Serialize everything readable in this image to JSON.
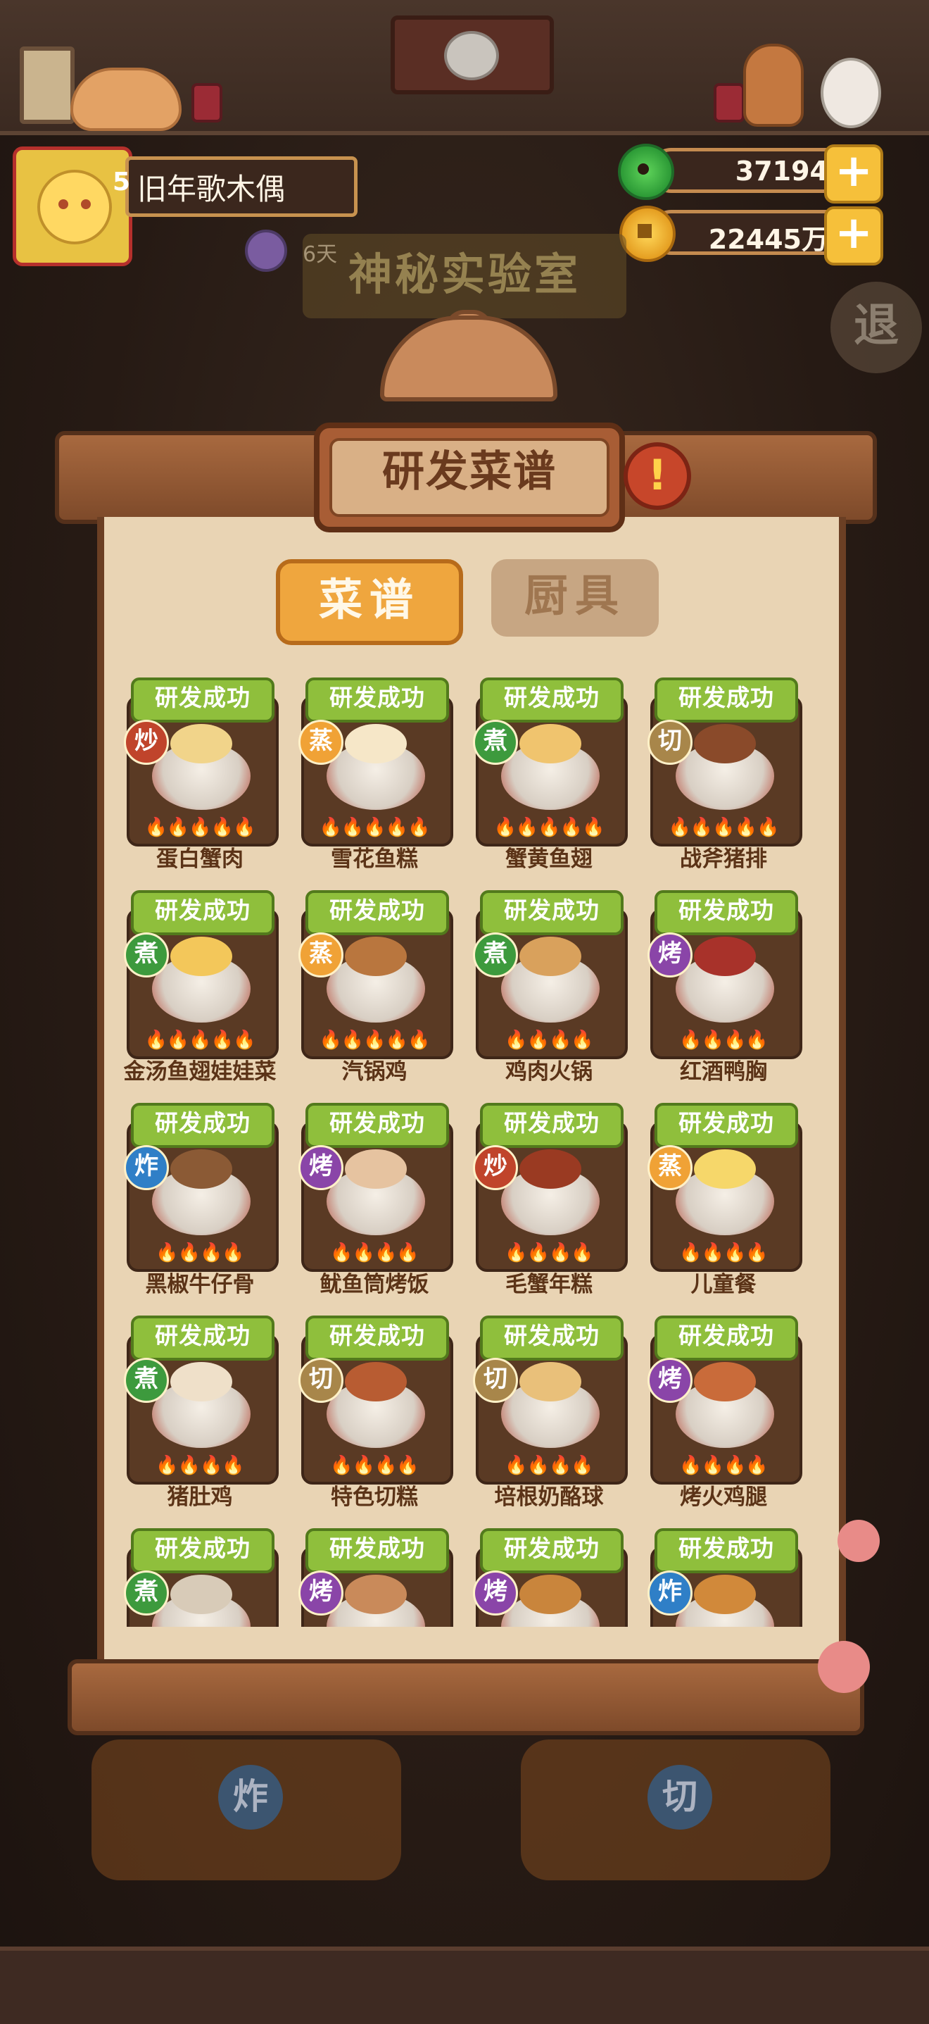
{
  "player": {
    "name": "旧年歌木偶",
    "level": "5",
    "status_days": "6天"
  },
  "resources": {
    "jade": "37194",
    "coins": "22445万",
    "plus": "+"
  },
  "background": {
    "lab_title": "神秘实验室",
    "exit_label": "退"
  },
  "panel": {
    "title": "研发菜谱",
    "alert": "!",
    "tabs": [
      "菜谱",
      "厨具"
    ]
  },
  "recipes": [
    {
      "name": "蛋白蟹肉",
      "method": "炒",
      "method_key": "chao",
      "status": "研发成功",
      "flames": "🔥🔥🔥🔥🔥",
      "food": "#f1d48a"
    },
    {
      "name": "雪花鱼糕",
      "method": "蒸",
      "method_key": "zheng",
      "status": "研发成功",
      "flames": "🔥🔥🔥🔥🔥",
      "food": "#f6e7c8"
    },
    {
      "name": "蟹黄鱼翅",
      "method": "煮",
      "method_key": "zhu",
      "status": "研发成功",
      "flames": "🔥🔥🔥🔥🔥",
      "food": "#f0c46e"
    },
    {
      "name": "战斧猪排",
      "method": "切",
      "method_key": "qie",
      "status": "研发成功",
      "flames": "🔥🔥🔥🔥🔥",
      "food": "#8a4a2a"
    },
    {
      "name": "金汤鱼翅娃娃菜",
      "method": "煮",
      "method_key": "zhu",
      "status": "研发成功",
      "flames": "🔥🔥🔥🔥🔥",
      "food": "#f3c75a"
    },
    {
      "name": "汽锅鸡",
      "method": "蒸",
      "method_key": "zheng",
      "status": "研发成功",
      "flames": "🔥🔥🔥🔥🔥",
      "food": "#b9763e"
    },
    {
      "name": "鸡肉火锅",
      "method": "煮",
      "method_key": "zhu",
      "status": "研发成功",
      "flames": "🔥🔥🔥🔥",
      "food": "#d9a15c"
    },
    {
      "name": "红酒鸭胸",
      "method": "烤",
      "method_key": "kao",
      "status": "研发成功",
      "flames": "🔥🔥🔥🔥",
      "food": "#a8322a"
    },
    {
      "name": "黑椒牛仔骨",
      "method": "炸",
      "method_key": "zha",
      "status": "研发成功",
      "flames": "🔥🔥🔥🔥",
      "food": "#8b5a35"
    },
    {
      "name": "鱿鱼筒烤饭",
      "method": "烤",
      "method_key": "kao",
      "status": "研发成功",
      "flames": "🔥🔥🔥🔥",
      "food": "#e6c3a0"
    },
    {
      "name": "毛蟹年糕",
      "method": "炒",
      "method_key": "chao",
      "status": "研发成功",
      "flames": "🔥🔥🔥🔥",
      "food": "#9a3a22"
    },
    {
      "name": "儿童餐",
      "method": "蒸",
      "method_key": "zheng",
      "status": "研发成功",
      "flames": "🔥🔥🔥🔥",
      "food": "#f6d76a"
    },
    {
      "name": "猪肚鸡",
      "method": "煮",
      "method_key": "zhu",
      "status": "研发成功",
      "flames": "🔥🔥🔥🔥",
      "food": "#efe0c9"
    },
    {
      "name": "特色切糕",
      "method": "切",
      "method_key": "qie",
      "status": "研发成功",
      "flames": "🔥🔥🔥🔥",
      "food": "#b85c32"
    },
    {
      "name": "培根奶酪球",
      "method": "切",
      "method_key": "qie",
      "status": "研发成功",
      "flames": "🔥🔥🔥🔥",
      "food": "#e9c07a"
    },
    {
      "name": "烤火鸡腿",
      "method": "烤",
      "method_key": "kao",
      "status": "研发成功",
      "flames": "🔥🔥🔥🔥",
      "food": "#c96b3a"
    },
    {
      "name": "",
      "method": "煮",
      "method_key": "zhu",
      "status": "研发成功",
      "flames": "",
      "food": "#d8cbb8"
    },
    {
      "name": "",
      "method": "烤",
      "method_key": "kao",
      "status": "研发成功",
      "flames": "",
      "food": "#c98a5a"
    },
    {
      "name": "",
      "method": "烤",
      "method_key": "kao",
      "status": "研发成功",
      "flames": "",
      "food": "#c9853c"
    },
    {
      "name": "",
      "method": "炸",
      "method_key": "zha",
      "status": "研发成功",
      "flames": "",
      "food": "#d1893a"
    }
  ],
  "bottom": {
    "left_method": "炸",
    "right_method": "切"
  }
}
